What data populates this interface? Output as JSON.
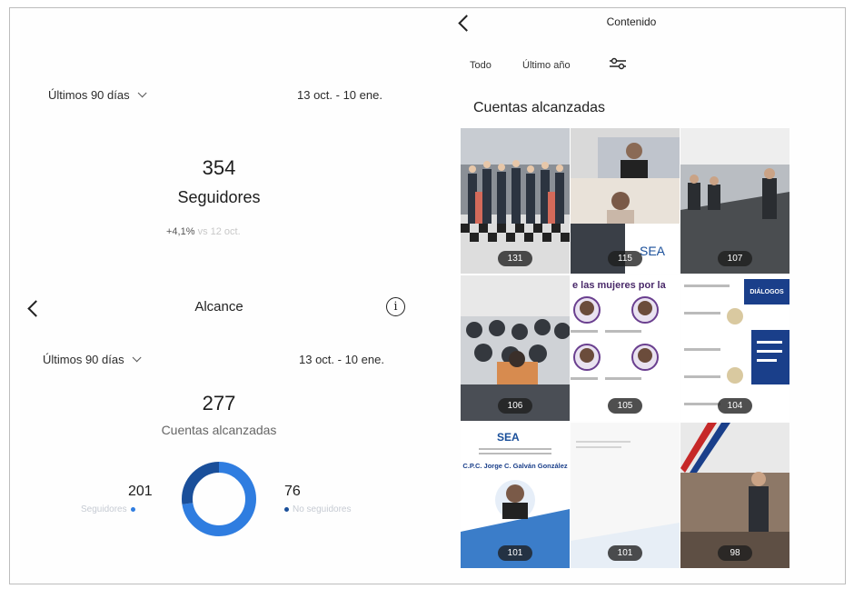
{
  "followers": {
    "range_label": "Últimos 90 días",
    "date_range": "13 oct. - 10 ene.",
    "value": "354",
    "label": "Seguidores",
    "growth": "+4,1%",
    "growth_note": "vs 12 oct."
  },
  "reach": {
    "title": "Alcance",
    "range_label": "Últimos 90 días",
    "date_range": "13 oct. - 10 ene.",
    "value": "277",
    "label": "Cuentas alcanzadas",
    "followers_value": "201",
    "followers_label": "Seguidores",
    "nonfollowers_value": "76",
    "nonfollowers_label": "No seguidores",
    "followers_fraction": 0.7256,
    "colors": {
      "followers": "#2f7de0",
      "nonfollowers": "#1a4f9a"
    }
  },
  "content": {
    "title": "Contenido",
    "tabs": [
      "Todo",
      "Último año"
    ],
    "section_heading": "Cuentas alcanzadas",
    "posts": [
      {
        "count": "131"
      },
      {
        "count": "115"
      },
      {
        "count": "107"
      },
      {
        "count": "106"
      },
      {
        "count": "105"
      },
      {
        "count": "104"
      },
      {
        "count": "101"
      },
      {
        "count": "101"
      },
      {
        "count": "98"
      }
    ],
    "post_texts": {
      "mujeres_banner": "e las mujeres por la",
      "sea_logo": "SEA",
      "speaker_name": "C.P.C. Jorge C. Galván González",
      "dialogo": "DIÁLOGOS"
    }
  }
}
